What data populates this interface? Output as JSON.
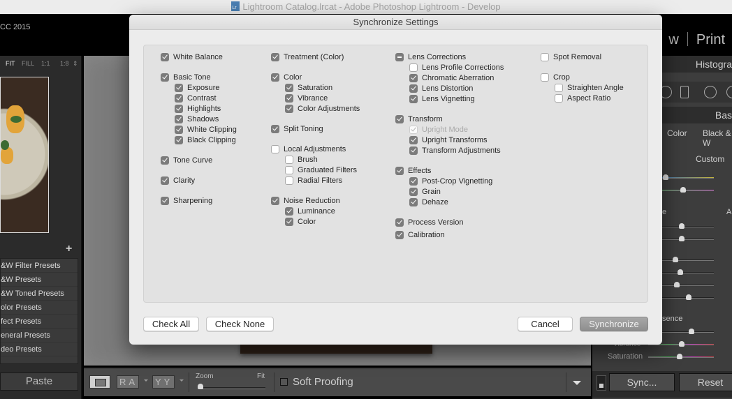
{
  "window": {
    "title": "Lightroom Catalog.lrcat - Adobe Photoshop Lightroom - Develop",
    "app_identity": "CC 2015"
  },
  "module_picker": {
    "partial_item": "w",
    "items": [
      "Print"
    ]
  },
  "left_panel": {
    "navigator_zoom": [
      "FIT",
      "FILL",
      "1:1",
      "1:8"
    ],
    "navigator_zoom_selected": "FIT",
    "presets_add_icon": "plus-icon",
    "presets": [
      "B&W Filter Presets",
      "B&W Presets",
      "B&W Toned Presets",
      "Color Presets",
      "Effect Presets",
      "General Presets",
      "Video Presets"
    ],
    "presets_visible": [
      "&W Filter Presets",
      "&W Presets",
      "&W Toned Presets",
      "olor Presets",
      "fect Presets",
      "eneral Presets",
      "deo Presets"
    ],
    "paste_label": "Paste"
  },
  "toolbar": {
    "loupe_icon": "loupe-view-icon",
    "before_after_label": "RA",
    "before_after_yy_label": "YY",
    "zoom_label": "Zoom",
    "fit_label": "Fit",
    "soft_proofing_label": "Soft Proofing",
    "soft_proofing_checked": false
  },
  "right_panel": {
    "histogram_label": "Histogra",
    "basic_label": "Bas",
    "treatment_color": "Color",
    "treatment_bw": "Black & W",
    "wb_preset": "Custom",
    "tone_label_fragment": "e",
    "auto_label_fragment": "A",
    "presence_label_fragment": "sence",
    "vibrance_label": "Vibrance",
    "saturation_label": "Saturation",
    "sync_label": "Sync...",
    "reset_label": "Reset"
  },
  "dialog": {
    "title": "Synchronize Settings",
    "columns": [
      [
        {
          "label": "White Balance",
          "state": "on",
          "level": 0
        },
        {
          "label": "Basic Tone",
          "state": "on",
          "level": 0,
          "gap": true
        },
        {
          "label": "Exposure",
          "state": "on",
          "level": 1
        },
        {
          "label": "Contrast",
          "state": "on",
          "level": 1
        },
        {
          "label": "Highlights",
          "state": "on",
          "level": 1
        },
        {
          "label": "Shadows",
          "state": "on",
          "level": 1
        },
        {
          "label": "White Clipping",
          "state": "on",
          "level": 1
        },
        {
          "label": "Black Clipping",
          "state": "on",
          "level": 1
        },
        {
          "label": "Tone Curve",
          "state": "on",
          "level": 0,
          "gap": true
        },
        {
          "label": "Clarity",
          "state": "on",
          "level": 0,
          "gap": true
        },
        {
          "label": "Sharpening",
          "state": "on",
          "level": 0,
          "gap": true
        }
      ],
      [
        {
          "label": "Treatment (Color)",
          "state": "on",
          "level": 0
        },
        {
          "label": "Color",
          "state": "on",
          "level": 0,
          "gap": true
        },
        {
          "label": "Saturation",
          "state": "on",
          "level": 1
        },
        {
          "label": "Vibrance",
          "state": "on",
          "level": 1
        },
        {
          "label": "Color Adjustments",
          "state": "on",
          "level": 1
        },
        {
          "label": "Split Toning",
          "state": "on",
          "level": 0,
          "gap": true
        },
        {
          "label": "Local Adjustments",
          "state": "off",
          "level": 0,
          "gap": true
        },
        {
          "label": "Brush",
          "state": "off",
          "level": 1
        },
        {
          "label": "Graduated Filters",
          "state": "off",
          "level": 1
        },
        {
          "label": "Radial Filters",
          "state": "off",
          "level": 1
        },
        {
          "label": "Noise Reduction",
          "state": "on",
          "level": 0,
          "gap": true
        },
        {
          "label": "Luminance",
          "state": "on",
          "level": 1
        },
        {
          "label": "Color",
          "state": "on",
          "level": 1
        }
      ],
      [
        {
          "label": "Lens Corrections",
          "state": "mixed",
          "level": 0
        },
        {
          "label": "Lens Profile Corrections",
          "state": "off",
          "level": 1
        },
        {
          "label": "Chromatic Aberration",
          "state": "on",
          "level": 1
        },
        {
          "label": "Lens Distortion",
          "state": "on",
          "level": 1
        },
        {
          "label": "Lens Vignetting",
          "state": "on",
          "level": 1
        },
        {
          "label": "Transform",
          "state": "on",
          "level": 0,
          "gap": true
        },
        {
          "label": "Upright Mode",
          "state": "dim",
          "level": 1,
          "disabled": true
        },
        {
          "label": "Upright Transforms",
          "state": "on",
          "level": 1
        },
        {
          "label": "Transform Adjustments",
          "state": "on",
          "level": 1
        },
        {
          "label": "Effects",
          "state": "on",
          "level": 0,
          "gap": true
        },
        {
          "label": "Post-Crop Vignetting",
          "state": "on",
          "level": 1
        },
        {
          "label": "Grain",
          "state": "on",
          "level": 1
        },
        {
          "label": "Dehaze",
          "state": "on",
          "level": 1
        },
        {
          "label": "Process Version",
          "state": "on",
          "level": 0,
          "gap": true
        },
        {
          "label": "Calibration",
          "state": "on",
          "level": 0,
          "half_gap": true
        }
      ],
      [
        {
          "label": "Spot Removal",
          "state": "off",
          "level": 0
        },
        {
          "label": "Crop",
          "state": "off",
          "level": 0,
          "gap": true
        },
        {
          "label": "Straighten Angle",
          "state": "off",
          "level": 1
        },
        {
          "label": "Aspect Ratio",
          "state": "off",
          "level": 1
        }
      ]
    ],
    "buttons": {
      "check_all": "Check All",
      "check_none": "Check None",
      "cancel": "Cancel",
      "synchronize": "Synchronize"
    }
  }
}
